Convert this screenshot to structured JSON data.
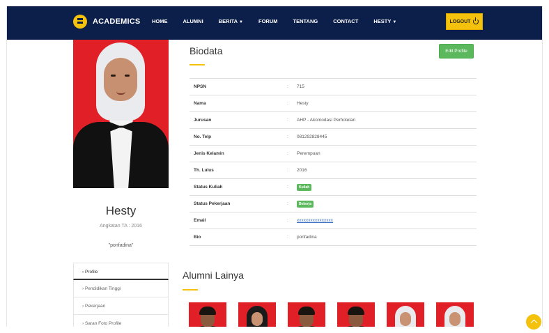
{
  "brand": {
    "name": "ACADEMICS"
  },
  "nav": {
    "items": [
      "HOME",
      "ALUMNI",
      "BERITA",
      "FORUM",
      "TENTANG",
      "CONTACT",
      "HESTY"
    ],
    "logout_label": "LOGOUT"
  },
  "profile": {
    "name": "Hesty",
    "class_line": "Angkatan TA : 2016",
    "bio_quote": "\"ponfadina\"",
    "menu": [
      "Profile",
      "Pendidikan Tinggi",
      "Pekerjaan",
      "Saran Foto Profile"
    ]
  },
  "biodata": {
    "title": "Biodata",
    "edit_label": "Edit Profile",
    "rows": [
      {
        "label": "NPSN",
        "value": "715"
      },
      {
        "label": "Nama",
        "value": "Hesty"
      },
      {
        "label": "Jurusan",
        "value": "AHP - Akomodasi Perhotelan"
      },
      {
        "label": "No. Telp",
        "value": "081292828445"
      },
      {
        "label": "Jenis Kelamin",
        "value": "Perempuan"
      },
      {
        "label": "Th. Lulus",
        "value": "2016"
      },
      {
        "label": "Status Kuliah",
        "value": "Kuliah"
      },
      {
        "label": "Status Pekerjaan",
        "value": "Bekerja"
      },
      {
        "label": "Email",
        "value": "xxxxxxxxxxxxxxxx"
      },
      {
        "label": "Bio",
        "value": "ponfadina"
      }
    ]
  },
  "alumni": {
    "title": "Alumni Lainya"
  },
  "colors": {
    "navbar": "#0c1f4a",
    "accent": "#f4c20d",
    "success": "#5cb85c",
    "photo_bg": "#e11f26"
  }
}
